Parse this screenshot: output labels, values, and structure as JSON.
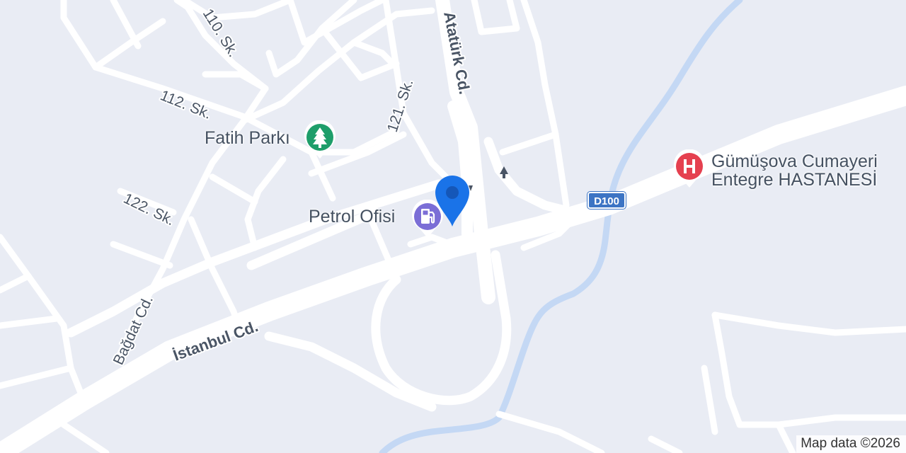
{
  "map": {
    "roads": {
      "istanbul": "İstanbul Cd.",
      "ataturk": "Atatürk Cd.",
      "bagdat": "Bağdat Cd.",
      "sk110": "110. Sk.",
      "sk112": "112. Sk.",
      "sk121": "121. Sk.",
      "sk122": "122. Sk."
    },
    "highway_shield": "D100",
    "pois": {
      "park": {
        "name": "Fatih Parkı",
        "icon": "tree-icon",
        "color": "#1e9e6a"
      },
      "fuel": {
        "name": "Petrol Ofisi",
        "icon": "fuel-pump-icon",
        "color": "#7b6ed6"
      },
      "hospital": {
        "name_line1": "Gümüşova Cumayeri",
        "name_line2": "Entegre HASTANESİ",
        "icon": "hospital-icon",
        "color": "#e5404f"
      }
    },
    "location_pin": {
      "icon": "location-pin-icon",
      "color": "#1a73e8"
    },
    "attribution": "Map data ©2026",
    "colors": {
      "land": "#e9ecf4",
      "road": "#ffffff",
      "water": "#c4d8f4"
    }
  }
}
